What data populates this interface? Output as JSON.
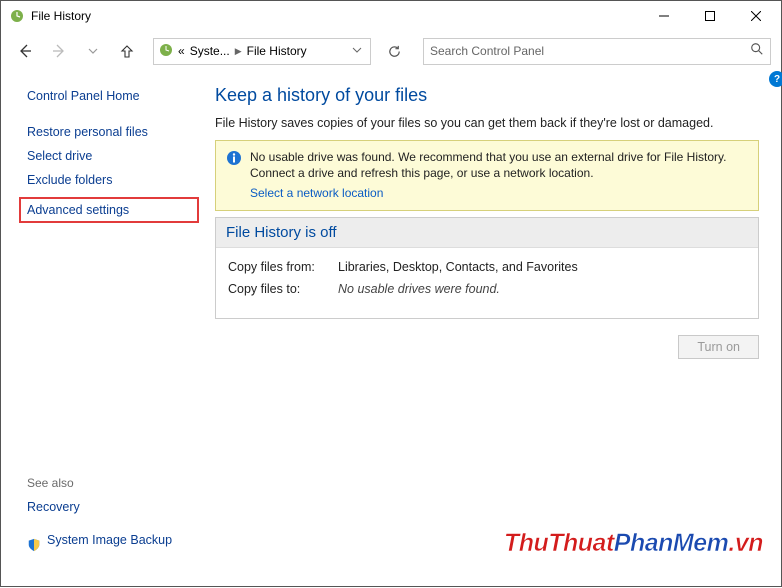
{
  "window": {
    "title": "File History"
  },
  "breadcrumb": {
    "seg1": "Syste...",
    "seg2": "File History"
  },
  "search": {
    "placeholder": "Search Control Panel"
  },
  "sidebar": {
    "home": "Control Panel Home",
    "items": [
      "Restore personal files",
      "Select drive",
      "Exclude folders",
      "Advanced settings"
    ]
  },
  "see_also": {
    "header": "See also",
    "items": [
      "Recovery",
      "System Image Backup"
    ]
  },
  "main": {
    "heading": "Keep a history of your files",
    "description": "File History saves copies of your files so you can get them back if they're lost or damaged.",
    "notice": {
      "text": "No usable drive was found. We recommend that you use an external drive for File History. Connect a drive and refresh this page, or use a network location.",
      "link": "Select a network location"
    },
    "status": {
      "header": "File History is off",
      "from_label": "Copy files from:",
      "from_value": "Libraries, Desktop, Contacts, and Favorites",
      "to_label": "Copy files to:",
      "to_value": "No usable drives were found."
    },
    "turn_on": "Turn on"
  },
  "watermark": {
    "part1": "ThuThuat",
    "part2": "PhanMem",
    "part3": ".vn"
  }
}
